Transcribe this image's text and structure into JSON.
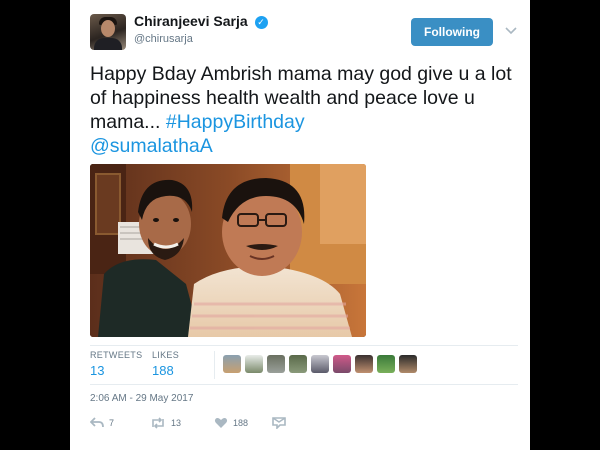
{
  "user": {
    "name": "Chiranjeevi Sarja",
    "handle": "@chirusarja"
  },
  "follow_button": {
    "label": "Following",
    "color": "#3a8fc4"
  },
  "tweet": {
    "text": "Happy Bday Ambrish mama may god give u a lot of happiness health wealth and peace love u mama... ",
    "hashtag": "#HappyBirthday",
    "mention": "@sumalathaA",
    "link_color": "#1b95e0"
  },
  "stats": {
    "retweets_label": "RETWEETS",
    "retweets": "13",
    "likes_label": "LIKES",
    "likes": "188"
  },
  "timestamp": "2:06 AM - 29 May 2017",
  "actions": {
    "replies": "7",
    "retweets": "13",
    "likes": "188"
  },
  "icons": {
    "verified": "verified-badge-icon",
    "chevron": "chevron-down-icon",
    "reply": "reply-icon",
    "retweet": "retweet-icon",
    "like": "heart-icon",
    "message": "direct-message-icon"
  }
}
